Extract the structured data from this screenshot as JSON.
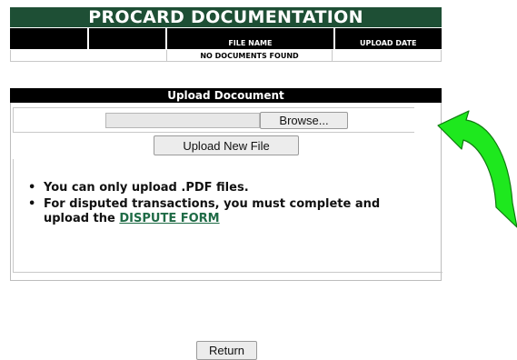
{
  "header": {
    "title": "PROCARD DOCUMENTATION",
    "columns": [
      "",
      "",
      "FILE NAME",
      "UPLOAD DATE"
    ],
    "empty_message": "NO DOCUMENTS FOUND"
  },
  "upload": {
    "title": "Upload Docoument",
    "browse_label": "Browse...",
    "upload_button_label": "Upload New File",
    "rules": [
      "You can only upload .PDF files.",
      "For disputed transactions, you must complete and upload the "
    ],
    "dispute_link": "DISPUTE FORM",
    "bullet": "•"
  },
  "footer": {
    "return_label": "Return"
  },
  "colors": {
    "header_green": "#1e4f35",
    "link_green": "#1f6b46",
    "arrow_green": "#1ee81e"
  },
  "icons": {
    "arrow": "curved-arrow-icon"
  }
}
